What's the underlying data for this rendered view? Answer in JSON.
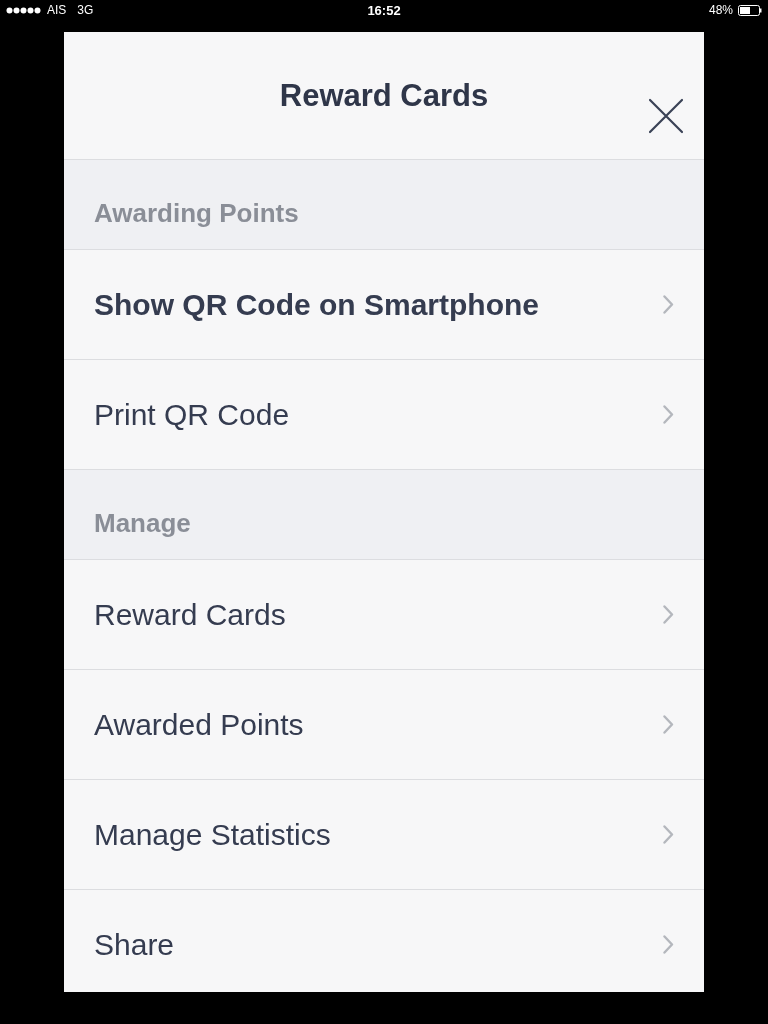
{
  "status_bar": {
    "carrier": "AIS",
    "network": "3G",
    "time": "16:52",
    "battery": "48%"
  },
  "dialog": {
    "title": "Reward Cards",
    "sections": [
      {
        "heading": "Awarding Points",
        "items": [
          {
            "label": "Show QR Code on Smartphone",
            "emphasized": true
          },
          {
            "label": "Print QR Code",
            "emphasized": false
          }
        ]
      },
      {
        "heading": "Manage",
        "items": [
          {
            "label": "Reward Cards",
            "emphasized": false
          },
          {
            "label": "Awarded Points",
            "emphasized": false
          },
          {
            "label": "Manage Statistics",
            "emphasized": false
          },
          {
            "label": "Share",
            "emphasized": false
          }
        ]
      }
    ]
  }
}
